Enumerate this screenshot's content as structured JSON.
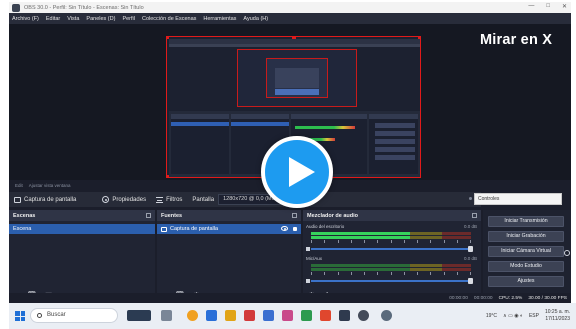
{
  "window": {
    "title": "OBS 30.0 - Perfil: Sin Título - Escenas: Sin Título"
  },
  "menu": [
    "Archivo (F)",
    "Editar",
    "Vista",
    "Paneles (D)",
    "Perfil",
    "Colección de Escenas",
    "Herramientas",
    "Ayuda (H)"
  ],
  "overlay": {
    "watch_label": "Mirar en X",
    "play_icon": "play-icon"
  },
  "scene_line": [
    "Edit",
    "Ajustar vista ventana"
  ],
  "toolbar": {
    "source_name": "Captura de pantalla",
    "properties_label": "Propiedades",
    "filters_label": "Filtros",
    "screen_label": "Pantalla",
    "resolution": "1280x720 @ 0,0 (Mo..."
  },
  "scenes": {
    "title": "Escenas",
    "items": [
      "Escena"
    ]
  },
  "sources": {
    "title": "Fuentes",
    "items": [
      "Captura de pantalla"
    ]
  },
  "mixer": {
    "title": "Mezclador de audio",
    "channels": [
      {
        "name": "Audio del escritorio",
        "db": "0.0 dB",
        "level": 0.62
      },
      {
        "name": "Mic/Aux",
        "db": "0.0 dB",
        "level": 0.0
      }
    ],
    "scale": [
      "-60",
      "-55",
      "-50",
      "-45",
      "-40",
      "-35",
      "-30",
      "-25",
      "-20",
      "-15",
      "-10",
      "-5",
      "0"
    ]
  },
  "controls": {
    "title": "Controles",
    "buttons": [
      "Iniciar Transmisión",
      "Iniciar Grabación",
      "Iniciar Cámara Virtual",
      "Modo Estudio",
      "Ajustes"
    ]
  },
  "dock_footer": [
    "+",
    "🗑",
    "⚙",
    "∧",
    "∨"
  ],
  "status": {
    "rec": "00:00:00",
    "stream": "00:00:00",
    "cpu": "CPU: 2.5%",
    "fps": "30.00 / 30.00 FPS"
  },
  "taskbar": {
    "search_label": "Buscar",
    "weather": "19°C",
    "lang": "ESP",
    "time": "10:25 a. m.",
    "date": "17/11/2023"
  },
  "colors": {
    "accent": "#1d9bf0",
    "selection": "#2b5fae",
    "preview_border": "#e11a1a"
  }
}
